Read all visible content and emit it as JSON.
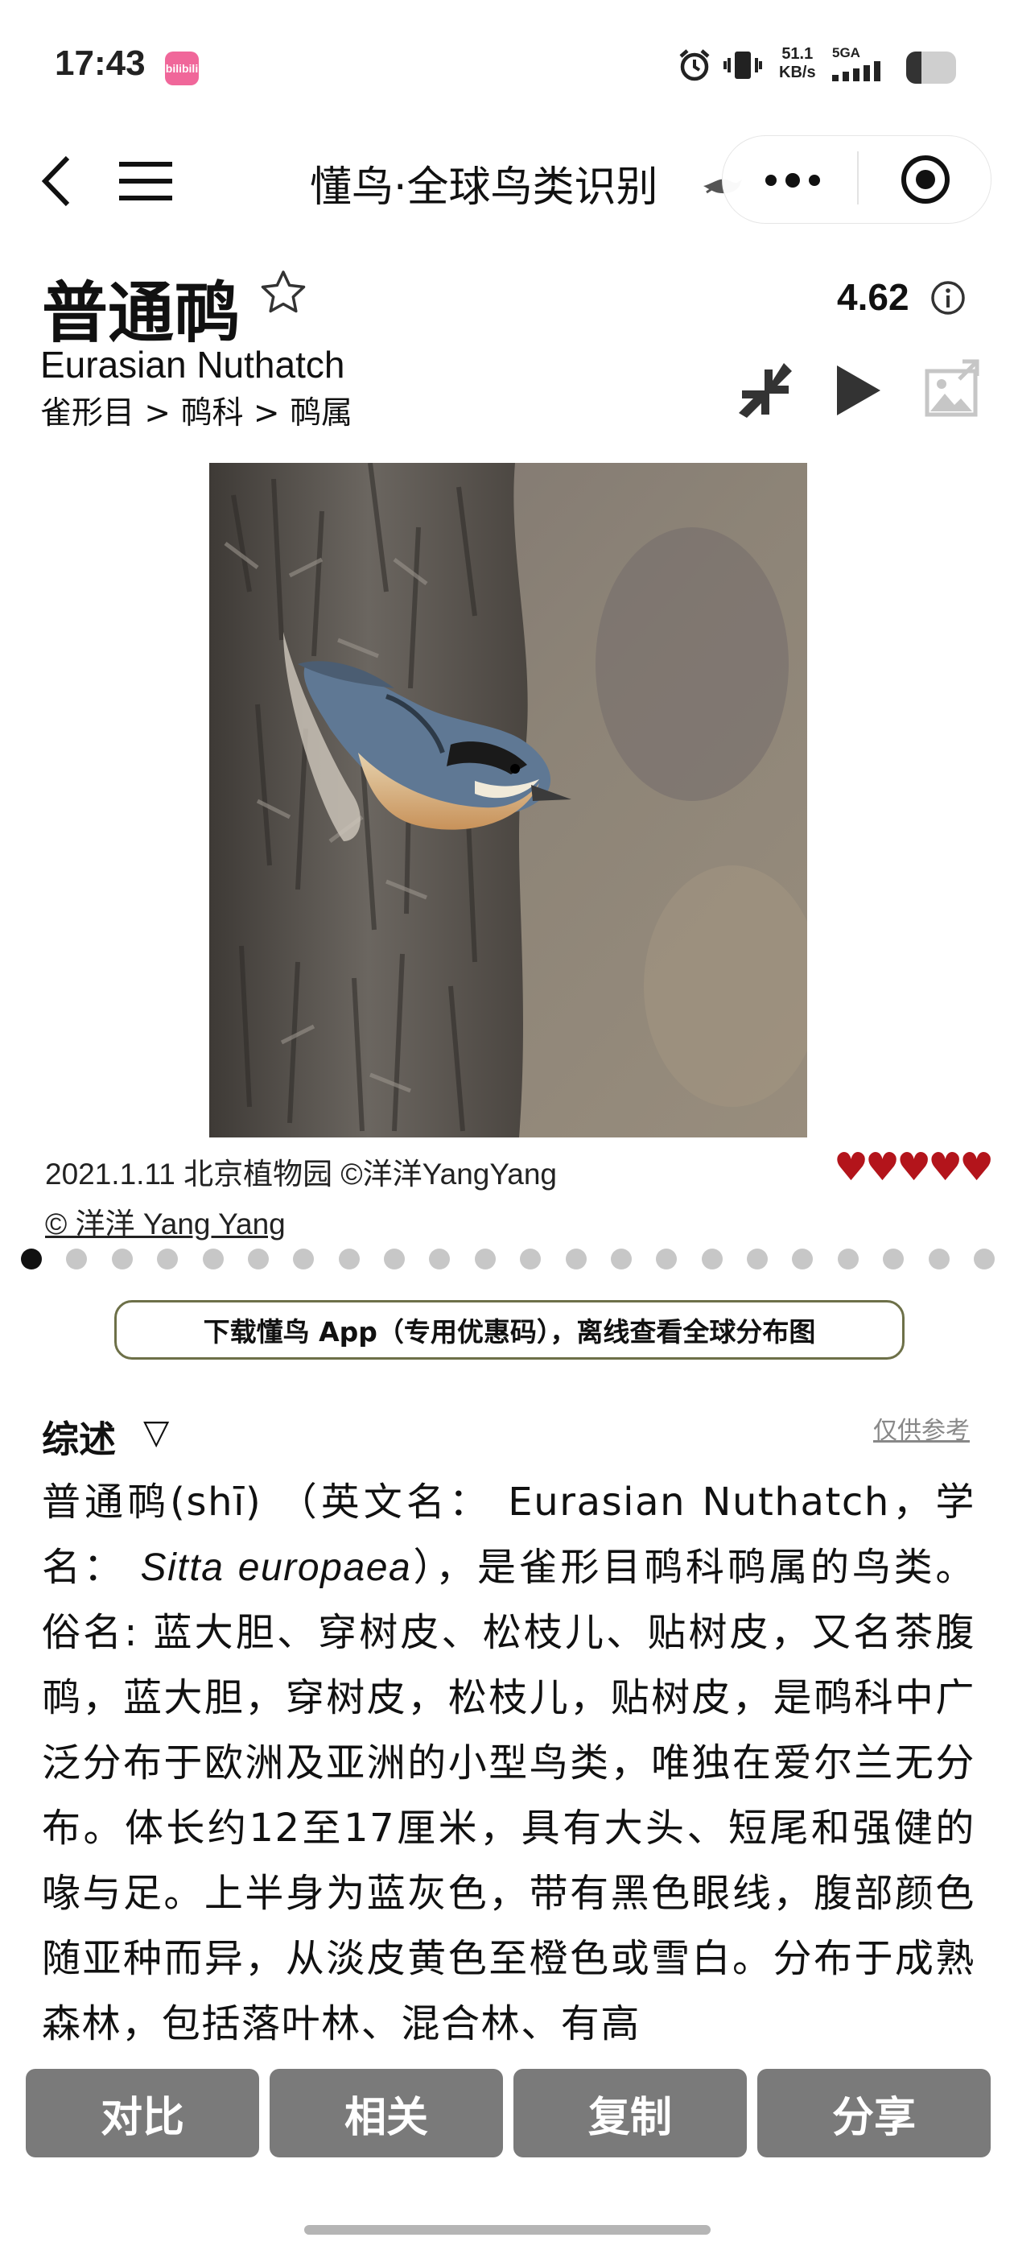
{
  "status_bar": {
    "time": "17:43",
    "app_badge": "bilibili",
    "speed_value": "51.1",
    "speed_unit": "KB/s",
    "network": "5GA",
    "battery_level": 0.3
  },
  "nav": {
    "title": "懂鸟·全球鸟类识别"
  },
  "species": {
    "name_cn": "普通䴓",
    "score": "4.62",
    "name_en": "Eurasian Nuthatch",
    "taxonomy": "雀形目 > 䴓科 > 䴓属"
  },
  "photo": {
    "caption": "2021.1.11 北京植物园 ©洋洋YangYang",
    "credit": "© 洋洋 Yang Yang",
    "hearts": "♥♥♥♥♥",
    "rating": 5,
    "dot_count": 22,
    "active_dot": 0
  },
  "banner": {
    "text": "下载懂鸟 App（专用优惠码），离线查看全球分布图"
  },
  "section": {
    "title": "综述",
    "toggle": "▽",
    "reference": "仅供参考",
    "text_before": "普通䴓(shī) （英文名： Eurasian Nuthatch，学名： ",
    "sci_name": "Sitta europaea",
    "text_after": "），是雀形目䴓科䴓属的鸟类。俗名: 蓝大胆、穿树皮、松枝儿、贴树皮，又名茶腹䴓，蓝大胆，穿树皮，松枝儿，贴树皮，是䴓科中广泛分布于欧洲及亚洲的小型鸟类，唯独在爱尔兰无分布。体长约12至17厘米，具有大头、短尾和强健的喙与足。上半身为蓝灰色，带有黑色眼线，腹部颜色随亚种而异，从淡皮黄色至橙色或雪白。分布于成熟森林，包括落叶林、混合林、有高"
  },
  "actions": {
    "compare": "对比",
    "related": "相关",
    "copy": "复制",
    "share": "分享"
  },
  "colors": {
    "heart": "#b3141b",
    "button_bg": "#7a7a7a",
    "banner_border": "#6d7048"
  }
}
